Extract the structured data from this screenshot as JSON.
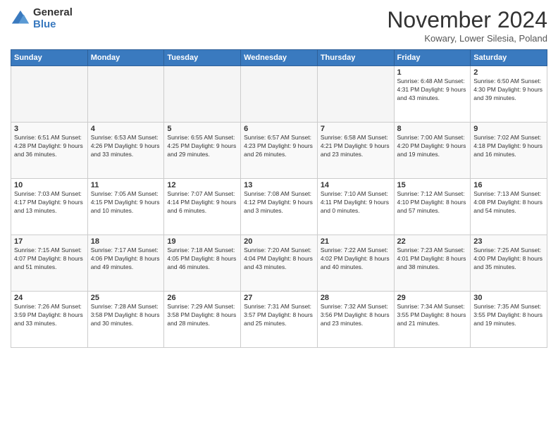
{
  "logo": {
    "general": "General",
    "blue": "Blue"
  },
  "title": "November 2024",
  "subtitle": "Kowary, Lower Silesia, Poland",
  "headers": [
    "Sunday",
    "Monday",
    "Tuesday",
    "Wednesday",
    "Thursday",
    "Friday",
    "Saturday"
  ],
  "weeks": [
    [
      {
        "day": "",
        "info": ""
      },
      {
        "day": "",
        "info": ""
      },
      {
        "day": "",
        "info": ""
      },
      {
        "day": "",
        "info": ""
      },
      {
        "day": "",
        "info": ""
      },
      {
        "day": "1",
        "info": "Sunrise: 6:48 AM\nSunset: 4:31 PM\nDaylight: 9 hours\nand 43 minutes."
      },
      {
        "day": "2",
        "info": "Sunrise: 6:50 AM\nSunset: 4:30 PM\nDaylight: 9 hours\nand 39 minutes."
      }
    ],
    [
      {
        "day": "3",
        "info": "Sunrise: 6:51 AM\nSunset: 4:28 PM\nDaylight: 9 hours\nand 36 minutes."
      },
      {
        "day": "4",
        "info": "Sunrise: 6:53 AM\nSunset: 4:26 PM\nDaylight: 9 hours\nand 33 minutes."
      },
      {
        "day": "5",
        "info": "Sunrise: 6:55 AM\nSunset: 4:25 PM\nDaylight: 9 hours\nand 29 minutes."
      },
      {
        "day": "6",
        "info": "Sunrise: 6:57 AM\nSunset: 4:23 PM\nDaylight: 9 hours\nand 26 minutes."
      },
      {
        "day": "7",
        "info": "Sunrise: 6:58 AM\nSunset: 4:21 PM\nDaylight: 9 hours\nand 23 minutes."
      },
      {
        "day": "8",
        "info": "Sunrise: 7:00 AM\nSunset: 4:20 PM\nDaylight: 9 hours\nand 19 minutes."
      },
      {
        "day": "9",
        "info": "Sunrise: 7:02 AM\nSunset: 4:18 PM\nDaylight: 9 hours\nand 16 minutes."
      }
    ],
    [
      {
        "day": "10",
        "info": "Sunrise: 7:03 AM\nSunset: 4:17 PM\nDaylight: 9 hours\nand 13 minutes."
      },
      {
        "day": "11",
        "info": "Sunrise: 7:05 AM\nSunset: 4:15 PM\nDaylight: 9 hours\nand 10 minutes."
      },
      {
        "day": "12",
        "info": "Sunrise: 7:07 AM\nSunset: 4:14 PM\nDaylight: 9 hours\nand 6 minutes."
      },
      {
        "day": "13",
        "info": "Sunrise: 7:08 AM\nSunset: 4:12 PM\nDaylight: 9 hours\nand 3 minutes."
      },
      {
        "day": "14",
        "info": "Sunrise: 7:10 AM\nSunset: 4:11 PM\nDaylight: 9 hours\nand 0 minutes."
      },
      {
        "day": "15",
        "info": "Sunrise: 7:12 AM\nSunset: 4:10 PM\nDaylight: 8 hours\nand 57 minutes."
      },
      {
        "day": "16",
        "info": "Sunrise: 7:13 AM\nSunset: 4:08 PM\nDaylight: 8 hours\nand 54 minutes."
      }
    ],
    [
      {
        "day": "17",
        "info": "Sunrise: 7:15 AM\nSunset: 4:07 PM\nDaylight: 8 hours\nand 51 minutes."
      },
      {
        "day": "18",
        "info": "Sunrise: 7:17 AM\nSunset: 4:06 PM\nDaylight: 8 hours\nand 49 minutes."
      },
      {
        "day": "19",
        "info": "Sunrise: 7:18 AM\nSunset: 4:05 PM\nDaylight: 8 hours\nand 46 minutes."
      },
      {
        "day": "20",
        "info": "Sunrise: 7:20 AM\nSunset: 4:04 PM\nDaylight: 8 hours\nand 43 minutes."
      },
      {
        "day": "21",
        "info": "Sunrise: 7:22 AM\nSunset: 4:02 PM\nDaylight: 8 hours\nand 40 minutes."
      },
      {
        "day": "22",
        "info": "Sunrise: 7:23 AM\nSunset: 4:01 PM\nDaylight: 8 hours\nand 38 minutes."
      },
      {
        "day": "23",
        "info": "Sunrise: 7:25 AM\nSunset: 4:00 PM\nDaylight: 8 hours\nand 35 minutes."
      }
    ],
    [
      {
        "day": "24",
        "info": "Sunrise: 7:26 AM\nSunset: 3:59 PM\nDaylight: 8 hours\nand 33 minutes."
      },
      {
        "day": "25",
        "info": "Sunrise: 7:28 AM\nSunset: 3:58 PM\nDaylight: 8 hours\nand 30 minutes."
      },
      {
        "day": "26",
        "info": "Sunrise: 7:29 AM\nSunset: 3:58 PM\nDaylight: 8 hours\nand 28 minutes."
      },
      {
        "day": "27",
        "info": "Sunrise: 7:31 AM\nSunset: 3:57 PM\nDaylight: 8 hours\nand 25 minutes."
      },
      {
        "day": "28",
        "info": "Sunrise: 7:32 AM\nSunset: 3:56 PM\nDaylight: 8 hours\nand 23 minutes."
      },
      {
        "day": "29",
        "info": "Sunrise: 7:34 AM\nSunset: 3:55 PM\nDaylight: 8 hours\nand 21 minutes."
      },
      {
        "day": "30",
        "info": "Sunrise: 7:35 AM\nSunset: 3:55 PM\nDaylight: 8 hours\nand 19 minutes."
      }
    ]
  ]
}
